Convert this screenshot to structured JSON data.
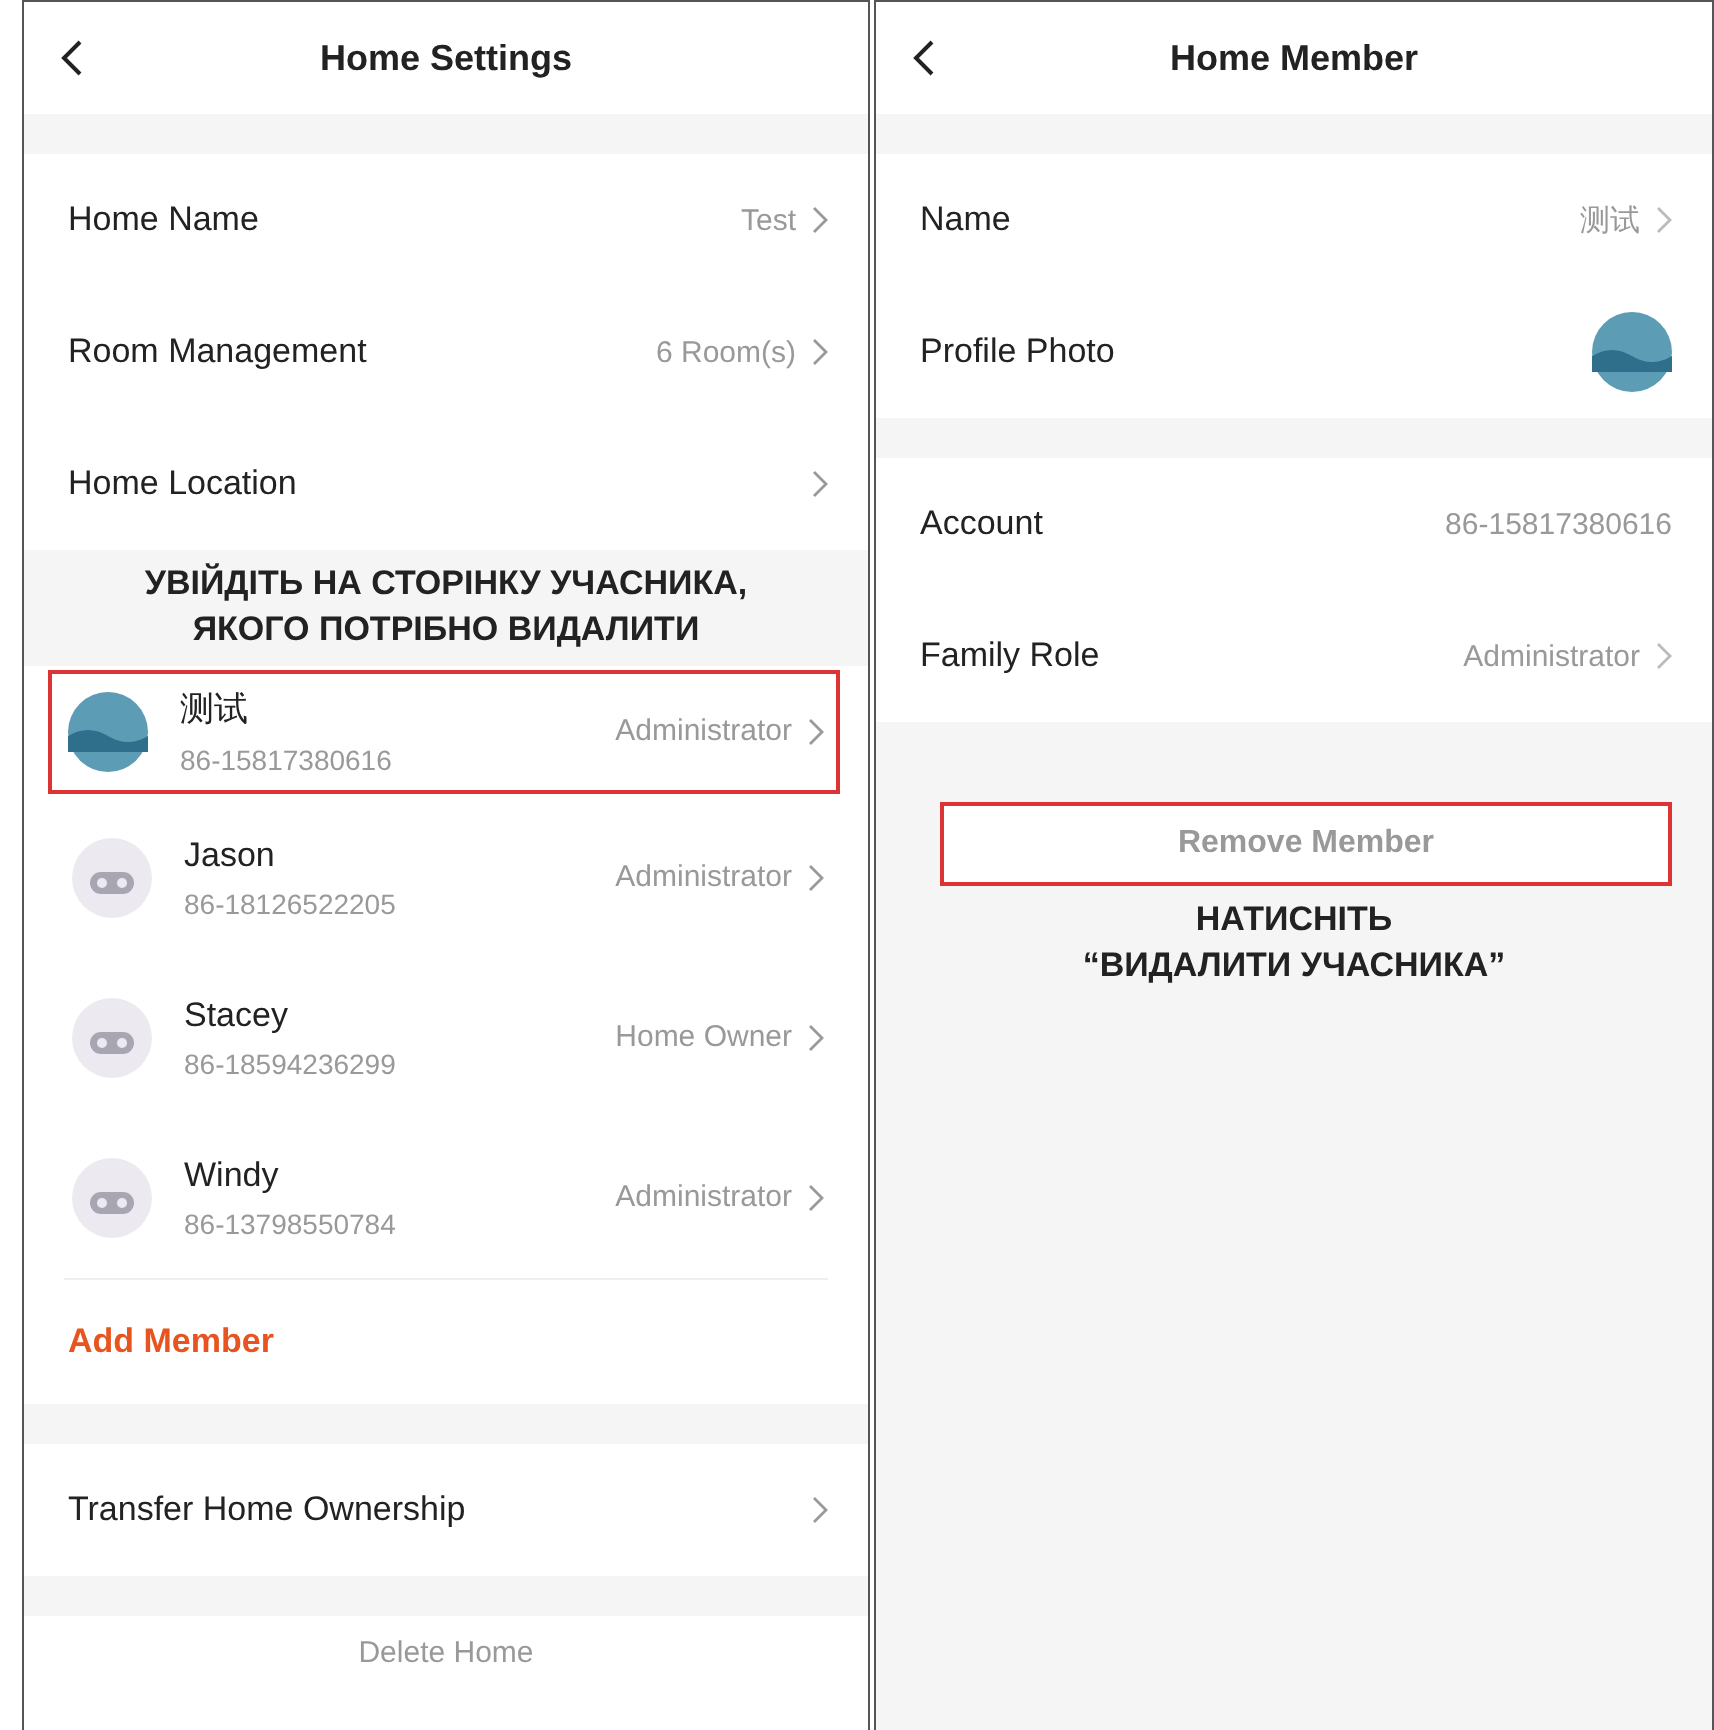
{
  "home_settings": {
    "title": "Home Settings",
    "rows": [
      {
        "label": "Home Name",
        "value": "Test"
      },
      {
        "label": "Room Management",
        "value": "6 Room(s)"
      },
      {
        "label": "Home Location"
      }
    ],
    "annotation": [
      "УВІЙДІТЬ НА СТОРІНКУ УЧАСНИКА,",
      "ЯКОГО ПОТРІБНО ВИДАЛИТИ"
    ],
    "members": [
      {
        "name": "测试",
        "account": "86-15817380616",
        "role": "Administrator",
        "kind": "photo",
        "highlighted": true
      },
      {
        "name": "Jason",
        "account": "86-18126522205",
        "role": "Administrator",
        "kind": "default",
        "highlighted": false
      },
      {
        "name": "Stacey",
        "account": "86-18594236299",
        "role": "Home Owner",
        "kind": "default",
        "highlighted": false
      },
      {
        "name": "Windy",
        "account": "86-13798550784",
        "role": "Administrator",
        "kind": "default",
        "highlighted": false
      }
    ],
    "add_member": "Add Member",
    "transfer": "Transfer Home Ownership",
    "delete": "Delete Home"
  },
  "home_member": {
    "title": "Home Member",
    "groups": [
      [
        {
          "label": "Name",
          "value": "测试",
          "kind": "link"
        },
        {
          "label": "Profile Photo",
          "kind": "photo"
        }
      ],
      [
        {
          "label": "Account",
          "value": "86-15817380616",
          "kind": "text"
        },
        {
          "label": "Family Role",
          "value": "Administrator",
          "kind": "link"
        }
      ]
    ],
    "remove": {
      "label": "Remove Member",
      "highlighted": true
    },
    "annotation": [
      "НАТИСНІТЬ",
      "“ВИДАЛИТИ УЧАСНИКА”"
    ]
  }
}
